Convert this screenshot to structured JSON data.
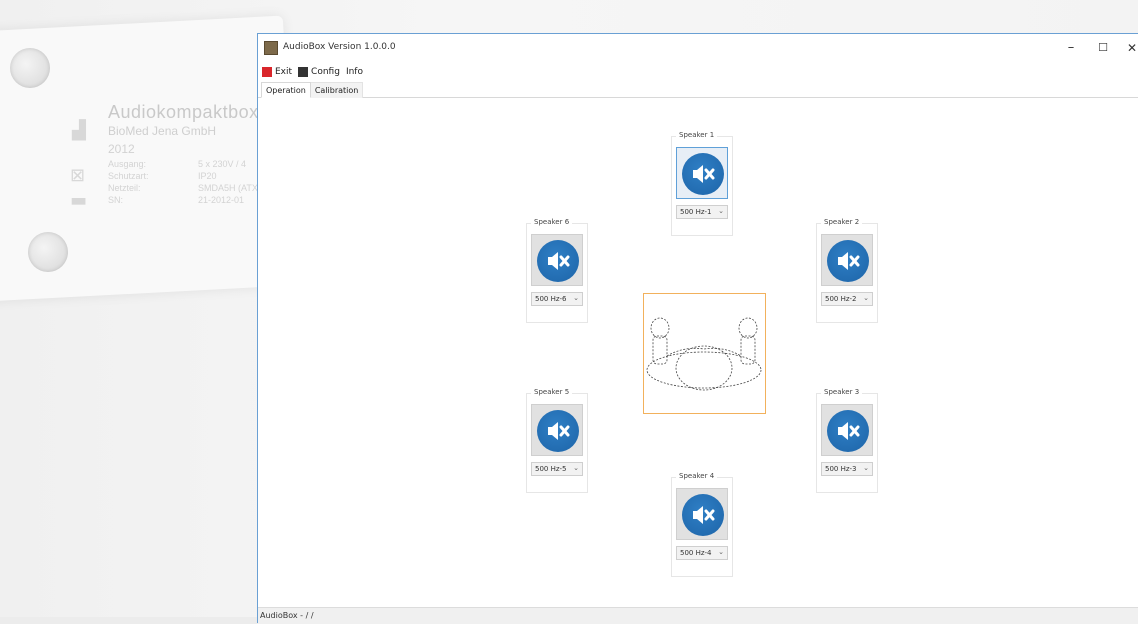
{
  "background_plate": {
    "title": "Audiokompaktbox",
    "manufacturer": "BioMed Jena GmbH",
    "year": "2012",
    "rows": [
      {
        "label": "Ausgang:",
        "value": "5 x 230V / 4"
      },
      {
        "label": "Schutzart:",
        "value": "IP20"
      },
      {
        "label": "Netzteil:",
        "value": "SMDA5H (ATX"
      },
      {
        "label": "SN:",
        "value": "21-2012-01"
      }
    ]
  },
  "window": {
    "title": "AudioBox Version 1.0.0.0",
    "controls": {
      "minimize": "–",
      "maximize": "☐",
      "close": "✕"
    }
  },
  "menu": [
    {
      "label": "Exit",
      "icon": "exit-icon",
      "color": "#d9262b"
    },
    {
      "label": "Config",
      "icon": "config-icon",
      "color": "#333333"
    },
    {
      "label": "Info",
      "icon": null,
      "color": null
    }
  ],
  "tabs": [
    {
      "label": "Operation",
      "active": true
    },
    {
      "label": "Calibration",
      "active": false
    }
  ],
  "speakers": [
    {
      "id": 1,
      "label": "Speaker 1",
      "freq": "500 Hz-1",
      "focused": true
    },
    {
      "id": 2,
      "label": "Speaker 2",
      "freq": "500 Hz-2",
      "focused": false
    },
    {
      "id": 3,
      "label": "Speaker 3",
      "freq": "500 Hz-3",
      "focused": false
    },
    {
      "id": 4,
      "label": "Speaker 4",
      "freq": "500 Hz-4",
      "focused": false
    },
    {
      "id": 5,
      "label": "Speaker 5",
      "freq": "500 Hz-5",
      "focused": false
    },
    {
      "id": 6,
      "label": "Speaker 6",
      "freq": "500 Hz-6",
      "focused": false
    }
  ],
  "speaker_icon": "speaker-mute-icon",
  "accent_color": "#1f6fb5",
  "listener_border_color": "#f2b15c",
  "status": "AudioBox - / /"
}
